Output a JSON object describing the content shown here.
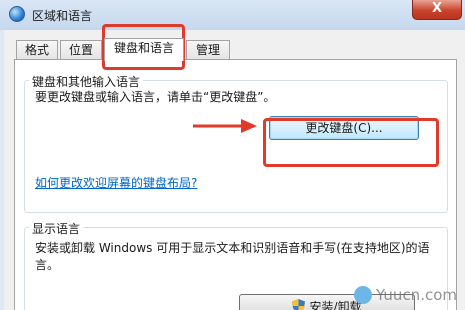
{
  "window": {
    "title": "区域和语言",
    "close_label": "X"
  },
  "tabs": [
    {
      "label": "格式",
      "active": false
    },
    {
      "label": "位置",
      "active": false
    },
    {
      "label": "键盘和语言",
      "active": true
    },
    {
      "label": "管理",
      "active": false
    }
  ],
  "keyboard_group": {
    "title": "键盘和其他输入语言",
    "description": "要更改键盘或输入语言，请单击“更改键盘”。",
    "change_button": "更改键盘(C)...",
    "help_link": "如何更改欢迎屏幕的键盘布局?"
  },
  "display_group": {
    "title": "显示语言",
    "description": "安装或卸载 Windows 可用于显示文本和识别语音和手写(在支持地区)的语言。",
    "install_button": "安装/卸载"
  },
  "annotation": {
    "highlight_color": "#e03a2b"
  },
  "watermark": {
    "text": "Yuucn.com"
  }
}
